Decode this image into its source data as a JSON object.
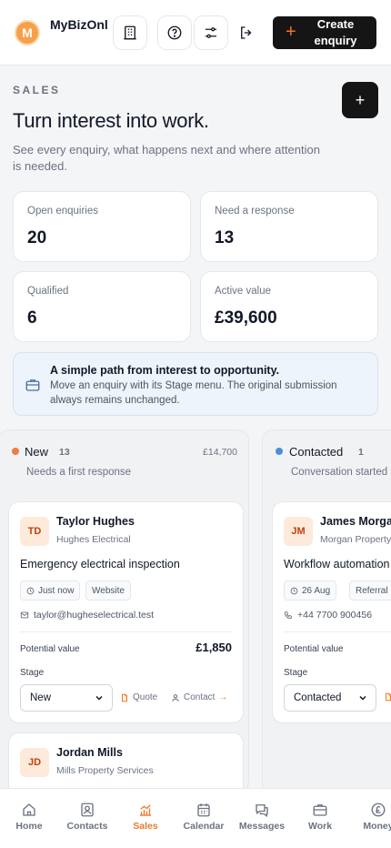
{
  "header": {
    "logo_letter": "M",
    "brand": "MyBizOnline OS",
    "create_label": "Create enquiry"
  },
  "hero": {
    "kicker": "SALES",
    "title": "Turn interest into work.",
    "description": "See every enquiry, what happens next and where attention is needed."
  },
  "stats": [
    {
      "label": "Open enquiries",
      "value": "20"
    },
    {
      "label": "Need a response",
      "value": "13"
    },
    {
      "label": "Qualified",
      "value": "6"
    },
    {
      "label": "Active value",
      "value": "£39,600"
    }
  ],
  "info": {
    "heading": "A simple path from interest to opportunity.",
    "body": "Move an enquiry with its Stage menu. The original submission always remains unchanged."
  },
  "columns": [
    {
      "name": "New",
      "count": "13",
      "amount": "£14,700",
      "subtitle": "Needs a first response",
      "dot_color": "#f07c45",
      "cards": [
        {
          "initials": "TD",
          "name": "Taylor Hughes",
          "company": "Hughes Electrical",
          "title": "Emergency electrical inspection",
          "time": "Just now",
          "source": "Website",
          "contact": "taylor@hugheselectrical.test",
          "potential_label": "Potential value",
          "potential_value": "£1,850",
          "stage_label": "Stage",
          "stage": "New",
          "quote_label": "Quote",
          "contact_label": "Contact"
        },
        {
          "initials": "JD",
          "name": "Jordan Mills",
          "company": "Mills Property Services"
        }
      ]
    },
    {
      "name": "Contacted",
      "count": "1",
      "amount": "",
      "subtitle": "Conversation started",
      "dot_color": "#4a8ed8",
      "cards": [
        {
          "initials": "JM",
          "name": "James Morgan",
          "company": "Morgan Property",
          "title": "Workflow automation",
          "time": "26 Aug",
          "source": "Referral",
          "contact": "+44 7700 900456",
          "potential_label": "Potential value",
          "stage_label": "Stage",
          "stage": "Contacted"
        }
      ]
    }
  ],
  "nav": [
    {
      "label": "Home",
      "icon": "home-icon"
    },
    {
      "label": "Contacts",
      "icon": "contacts-icon"
    },
    {
      "label": "Sales",
      "icon": "sales-chart-icon"
    },
    {
      "label": "Calendar",
      "icon": "calendar-icon"
    },
    {
      "label": "Messages",
      "icon": "messages-icon"
    },
    {
      "label": "Work",
      "icon": "briefcase-icon"
    },
    {
      "label": "Money",
      "icon": "pound-icon"
    }
  ],
  "nav_active": "Sales",
  "colors": {
    "accent": "#f97316",
    "dark": "#151515",
    "active_nav": "#ea7a2a"
  }
}
